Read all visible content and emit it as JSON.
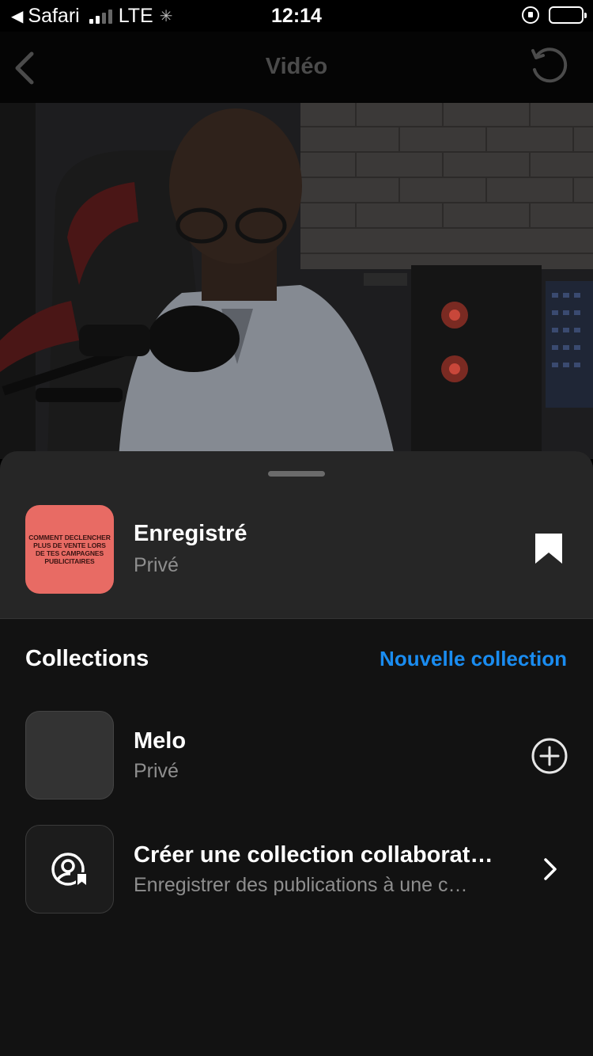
{
  "status_bar": {
    "back_app": "Safari",
    "network": "LTE",
    "time": "12:14"
  },
  "nav": {
    "title": "Vidéo"
  },
  "saved": {
    "title": "Enregistré",
    "subtitle": "Privé",
    "thumb_text": "COMMENT DECLENCHER PLUS DE VENTE LORS DE TES CAMPAGNES PUBLICITAIRES",
    "thumb_color": "#e86b64"
  },
  "collections": {
    "heading": "Collections",
    "new_label": "Nouvelle collection",
    "accent": "#1a8cf0",
    "items": [
      {
        "title": "Melo",
        "subtitle": "Privé",
        "icon": "plus-circle-icon"
      },
      {
        "title": "Créer une collection collaborat…",
        "subtitle": "Enregistrer des publications à une c…",
        "icon": "chevron-right-icon"
      }
    ]
  }
}
